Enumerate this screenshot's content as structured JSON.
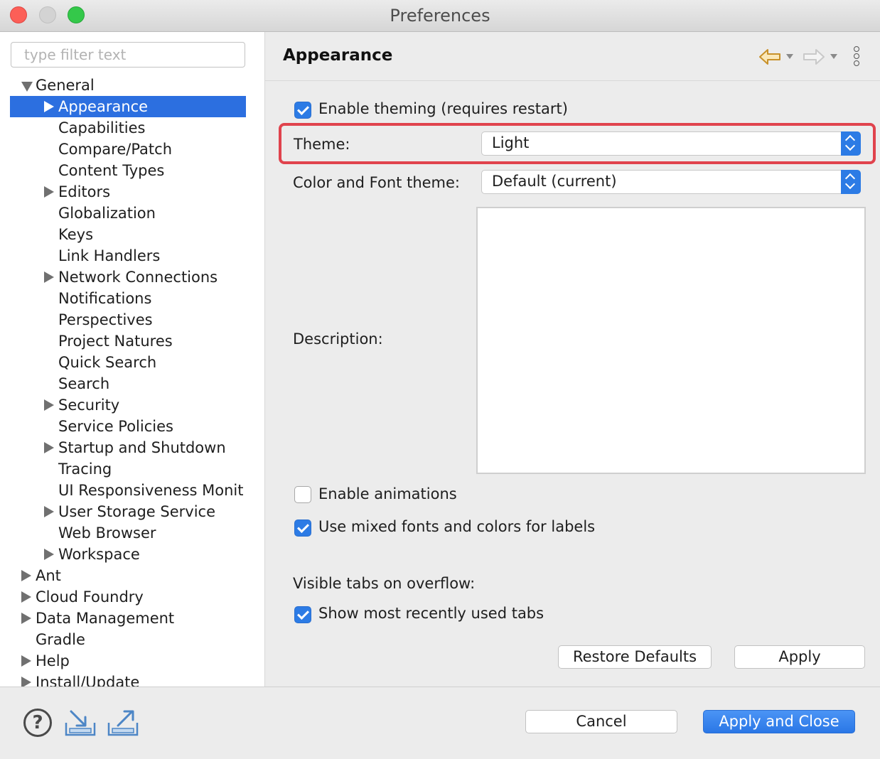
{
  "window": {
    "title": "Preferences"
  },
  "filter": {
    "placeholder": "type filter text",
    "value": ""
  },
  "tree": {
    "general": {
      "label": "General",
      "expanded": true
    },
    "general_children": [
      {
        "label": "Appearance",
        "has_children": true,
        "selected": true
      },
      {
        "label": "Capabilities",
        "has_children": false
      },
      {
        "label": "Compare/Patch",
        "has_children": false
      },
      {
        "label": "Content Types",
        "has_children": false
      },
      {
        "label": "Editors",
        "has_children": true
      },
      {
        "label": "Globalization",
        "has_children": false
      },
      {
        "label": "Keys",
        "has_children": false
      },
      {
        "label": "Link Handlers",
        "has_children": false
      },
      {
        "label": "Network Connections",
        "has_children": true
      },
      {
        "label": "Notifications",
        "has_children": false
      },
      {
        "label": "Perspectives",
        "has_children": false
      },
      {
        "label": "Project Natures",
        "has_children": false
      },
      {
        "label": "Quick Search",
        "has_children": false
      },
      {
        "label": "Search",
        "has_children": false
      },
      {
        "label": "Security",
        "has_children": true
      },
      {
        "label": "Service Policies",
        "has_children": false
      },
      {
        "label": "Startup and Shutdown",
        "has_children": true
      },
      {
        "label": "Tracing",
        "has_children": false
      },
      {
        "label": "UI Responsiveness Monit",
        "has_children": false
      },
      {
        "label": "User Storage Service",
        "has_children": true
      },
      {
        "label": "Web Browser",
        "has_children": false
      },
      {
        "label": "Workspace",
        "has_children": true
      }
    ],
    "top_level": [
      {
        "label": "Ant",
        "has_children": true
      },
      {
        "label": "Cloud Foundry",
        "has_children": true
      },
      {
        "label": "Data Management",
        "has_children": true
      },
      {
        "label": "Gradle",
        "has_children": false
      },
      {
        "label": "Help",
        "has_children": true
      },
      {
        "label": "Install/Update",
        "has_children": true
      }
    ]
  },
  "page": {
    "title": "Appearance",
    "icons": {
      "back": "back-arrow-icon",
      "forward": "forward-arrow-icon",
      "menu": "more-vertical-icon"
    }
  },
  "appearance": {
    "enable_theming": {
      "label": "Enable theming (requires restart)",
      "checked": true
    },
    "theme": {
      "label": "Theme:",
      "value": "Light"
    },
    "color_font_theme": {
      "label": "Color and Font theme:",
      "value": "Default (current)"
    },
    "description_label": "Description:",
    "description_value": "",
    "enable_animations": {
      "label": "Enable animations",
      "checked": false
    },
    "mixed_fonts": {
      "label": "Use mixed fonts and colors for labels",
      "checked": true
    },
    "visible_tabs_label": "Visible tabs on overflow:",
    "show_mru_tabs": {
      "label": "Show most recently used tabs",
      "checked": true
    }
  },
  "buttons": {
    "restore_defaults": "Restore Defaults",
    "apply": "Apply",
    "cancel": "Cancel",
    "apply_and_close": "Apply and Close"
  },
  "footer": {
    "icons": [
      "help-icon",
      "import-icon",
      "export-icon"
    ],
    "help_glyph": "?"
  },
  "colors": {
    "selection": "#2c6fe0",
    "accent": "#2c7be5",
    "highlight_border": "#e0434d",
    "back_arrow": "#d9a441"
  }
}
